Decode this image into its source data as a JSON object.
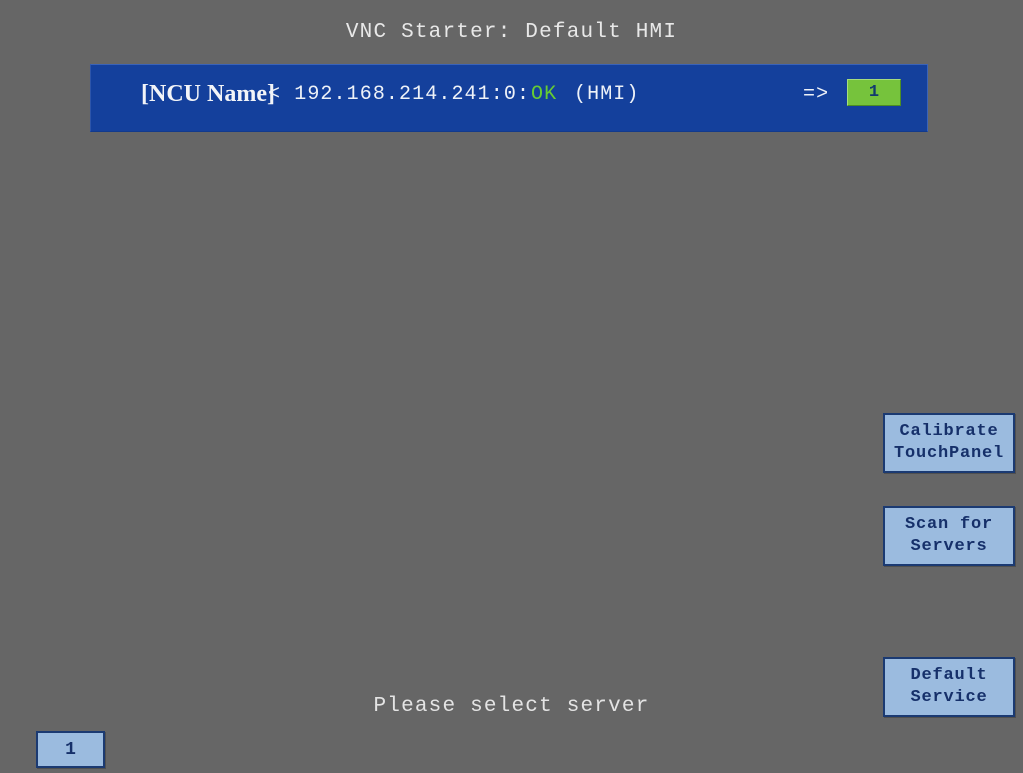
{
  "app": {
    "title": "VNC Starter: Default HMI",
    "background_color": "#666666"
  },
  "server_list": {
    "panel_color": "#14409c",
    "entries": [
      {
        "name": "[NCU Name]",
        "separator": "<",
        "address": "192.168.214.241:0:",
        "status": "OK",
        "status_color": "#66cc33",
        "type": "(HMI)",
        "arrow": "=>",
        "index": "1",
        "index_badge_color": "#76c33c"
      }
    ]
  },
  "softkeys": [
    {
      "label": "Calibrate\nTouchPanel",
      "line1": "Calibrate",
      "line2": "TouchPanel"
    },
    {
      "label": "Scan for\nServers",
      "line1": "Scan for",
      "line2": "Servers"
    },
    {
      "label": "Default\nService",
      "line1": "Default",
      "line2": "Service"
    }
  ],
  "index_button": {
    "label": "1"
  },
  "prompt": {
    "text": "Please select server"
  }
}
